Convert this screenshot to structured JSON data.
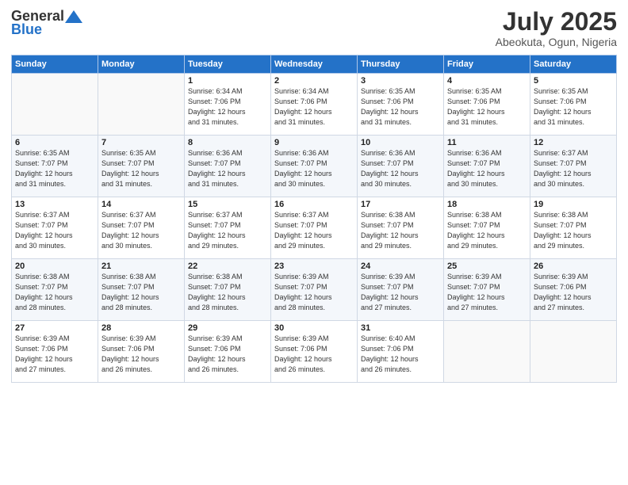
{
  "header": {
    "logo_general": "General",
    "logo_blue": "Blue",
    "month_title": "July 2025",
    "subtitle": "Abeokuta, Ogun, Nigeria"
  },
  "columns": [
    "Sunday",
    "Monday",
    "Tuesday",
    "Wednesday",
    "Thursday",
    "Friday",
    "Saturday"
  ],
  "weeks": [
    [
      {
        "day": "",
        "info": ""
      },
      {
        "day": "",
        "info": ""
      },
      {
        "day": "1",
        "info": "Sunrise: 6:34 AM\nSunset: 7:06 PM\nDaylight: 12 hours\nand 31 minutes."
      },
      {
        "day": "2",
        "info": "Sunrise: 6:34 AM\nSunset: 7:06 PM\nDaylight: 12 hours\nand 31 minutes."
      },
      {
        "day": "3",
        "info": "Sunrise: 6:35 AM\nSunset: 7:06 PM\nDaylight: 12 hours\nand 31 minutes."
      },
      {
        "day": "4",
        "info": "Sunrise: 6:35 AM\nSunset: 7:06 PM\nDaylight: 12 hours\nand 31 minutes."
      },
      {
        "day": "5",
        "info": "Sunrise: 6:35 AM\nSunset: 7:06 PM\nDaylight: 12 hours\nand 31 minutes."
      }
    ],
    [
      {
        "day": "6",
        "info": "Sunrise: 6:35 AM\nSunset: 7:07 PM\nDaylight: 12 hours\nand 31 minutes."
      },
      {
        "day": "7",
        "info": "Sunrise: 6:35 AM\nSunset: 7:07 PM\nDaylight: 12 hours\nand 31 minutes."
      },
      {
        "day": "8",
        "info": "Sunrise: 6:36 AM\nSunset: 7:07 PM\nDaylight: 12 hours\nand 31 minutes."
      },
      {
        "day": "9",
        "info": "Sunrise: 6:36 AM\nSunset: 7:07 PM\nDaylight: 12 hours\nand 30 minutes."
      },
      {
        "day": "10",
        "info": "Sunrise: 6:36 AM\nSunset: 7:07 PM\nDaylight: 12 hours\nand 30 minutes."
      },
      {
        "day": "11",
        "info": "Sunrise: 6:36 AM\nSunset: 7:07 PM\nDaylight: 12 hours\nand 30 minutes."
      },
      {
        "day": "12",
        "info": "Sunrise: 6:37 AM\nSunset: 7:07 PM\nDaylight: 12 hours\nand 30 minutes."
      }
    ],
    [
      {
        "day": "13",
        "info": "Sunrise: 6:37 AM\nSunset: 7:07 PM\nDaylight: 12 hours\nand 30 minutes."
      },
      {
        "day": "14",
        "info": "Sunrise: 6:37 AM\nSunset: 7:07 PM\nDaylight: 12 hours\nand 30 minutes."
      },
      {
        "day": "15",
        "info": "Sunrise: 6:37 AM\nSunset: 7:07 PM\nDaylight: 12 hours\nand 29 minutes."
      },
      {
        "day": "16",
        "info": "Sunrise: 6:37 AM\nSunset: 7:07 PM\nDaylight: 12 hours\nand 29 minutes."
      },
      {
        "day": "17",
        "info": "Sunrise: 6:38 AM\nSunset: 7:07 PM\nDaylight: 12 hours\nand 29 minutes."
      },
      {
        "day": "18",
        "info": "Sunrise: 6:38 AM\nSunset: 7:07 PM\nDaylight: 12 hours\nand 29 minutes."
      },
      {
        "day": "19",
        "info": "Sunrise: 6:38 AM\nSunset: 7:07 PM\nDaylight: 12 hours\nand 29 minutes."
      }
    ],
    [
      {
        "day": "20",
        "info": "Sunrise: 6:38 AM\nSunset: 7:07 PM\nDaylight: 12 hours\nand 28 minutes."
      },
      {
        "day": "21",
        "info": "Sunrise: 6:38 AM\nSunset: 7:07 PM\nDaylight: 12 hours\nand 28 minutes."
      },
      {
        "day": "22",
        "info": "Sunrise: 6:38 AM\nSunset: 7:07 PM\nDaylight: 12 hours\nand 28 minutes."
      },
      {
        "day": "23",
        "info": "Sunrise: 6:39 AM\nSunset: 7:07 PM\nDaylight: 12 hours\nand 28 minutes."
      },
      {
        "day": "24",
        "info": "Sunrise: 6:39 AM\nSunset: 7:07 PM\nDaylight: 12 hours\nand 27 minutes."
      },
      {
        "day": "25",
        "info": "Sunrise: 6:39 AM\nSunset: 7:07 PM\nDaylight: 12 hours\nand 27 minutes."
      },
      {
        "day": "26",
        "info": "Sunrise: 6:39 AM\nSunset: 7:06 PM\nDaylight: 12 hours\nand 27 minutes."
      }
    ],
    [
      {
        "day": "27",
        "info": "Sunrise: 6:39 AM\nSunset: 7:06 PM\nDaylight: 12 hours\nand 27 minutes."
      },
      {
        "day": "28",
        "info": "Sunrise: 6:39 AM\nSunset: 7:06 PM\nDaylight: 12 hours\nand 26 minutes."
      },
      {
        "day": "29",
        "info": "Sunrise: 6:39 AM\nSunset: 7:06 PM\nDaylight: 12 hours\nand 26 minutes."
      },
      {
        "day": "30",
        "info": "Sunrise: 6:39 AM\nSunset: 7:06 PM\nDaylight: 12 hours\nand 26 minutes."
      },
      {
        "day": "31",
        "info": "Sunrise: 6:40 AM\nSunset: 7:06 PM\nDaylight: 12 hours\nand 26 minutes."
      },
      {
        "day": "",
        "info": ""
      },
      {
        "day": "",
        "info": ""
      }
    ]
  ]
}
